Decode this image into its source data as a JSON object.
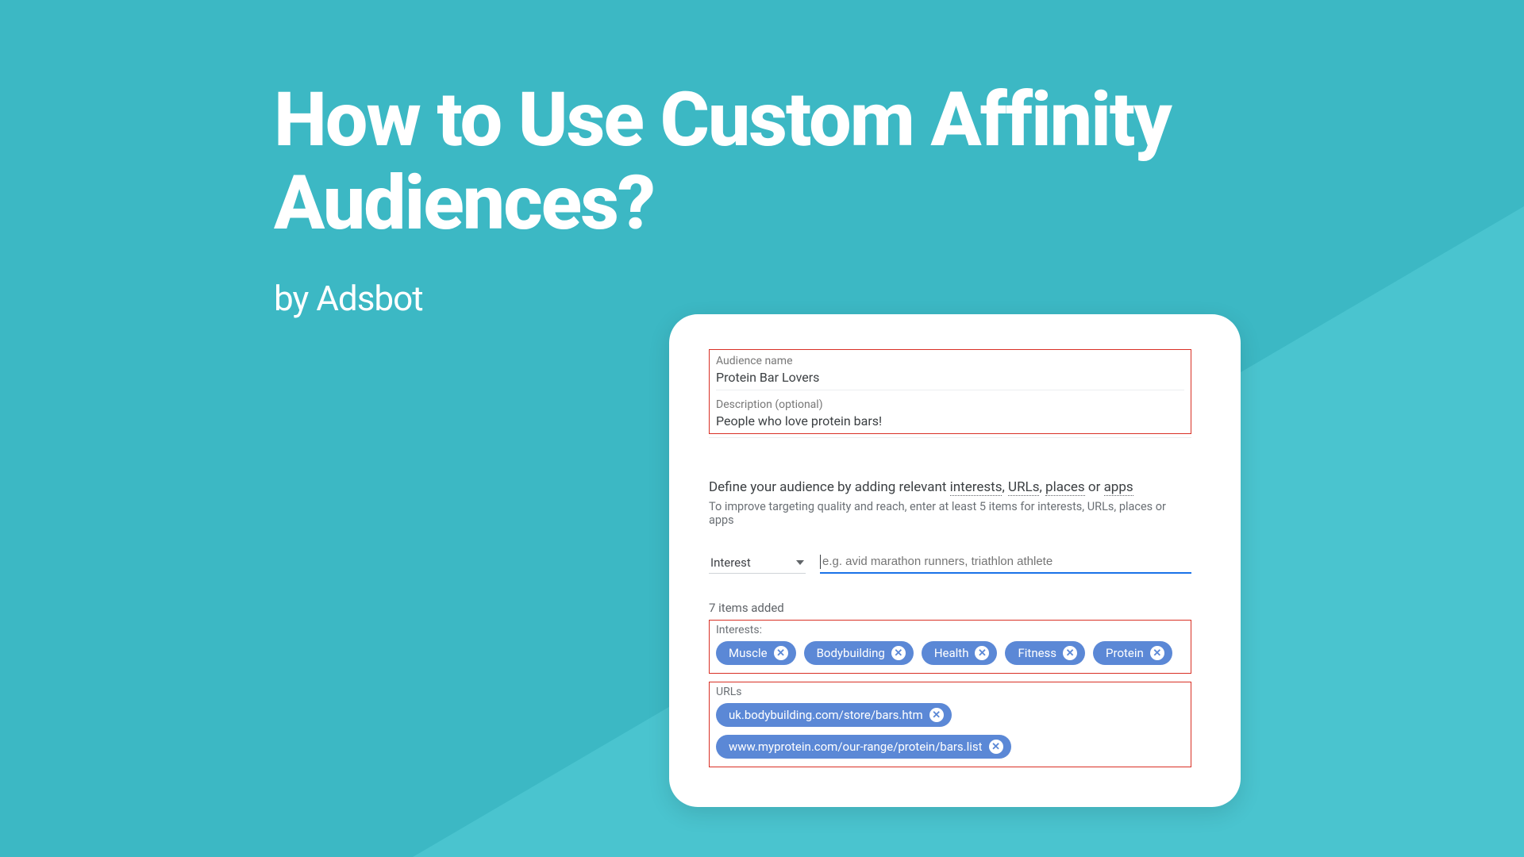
{
  "title": "How to Use Custom Affinity Audiences?",
  "byline": "by Adsbot",
  "card": {
    "audience_name_label": "Audience name",
    "audience_name_value": "Protein Bar Lovers",
    "description_label": "Description (optional)",
    "description_value": "People who love protein bars!",
    "define_prefix": "Define your audience by adding relevant ",
    "define_interests": "interests",
    "define_sep1": ", ",
    "define_urls": "URLs",
    "define_sep2": ", ",
    "define_places": "places",
    "define_sep3": " or ",
    "define_apps": "apps",
    "subline": "To improve targeting quality and reach, enter at least 5 items for interests, URLs, places or apps",
    "selector_label": "Interest",
    "input_placeholder": "e.g. avid marathon runners, triathlon athlete",
    "items_added": "7 items added",
    "interests_label": "Interests:",
    "interests": [
      "Muscle",
      "Bodybuilding",
      "Health",
      "Fitness",
      "Protein"
    ],
    "urls_label": "URLs",
    "urls": [
      "uk.bodybuilding.com/store/bars.htm",
      "www.myprotein.com/our-range/protein/bars.list"
    ]
  },
  "colors": {
    "chip": "#5b88d6",
    "accent": "#1a73e8",
    "danger": "#d93025"
  }
}
